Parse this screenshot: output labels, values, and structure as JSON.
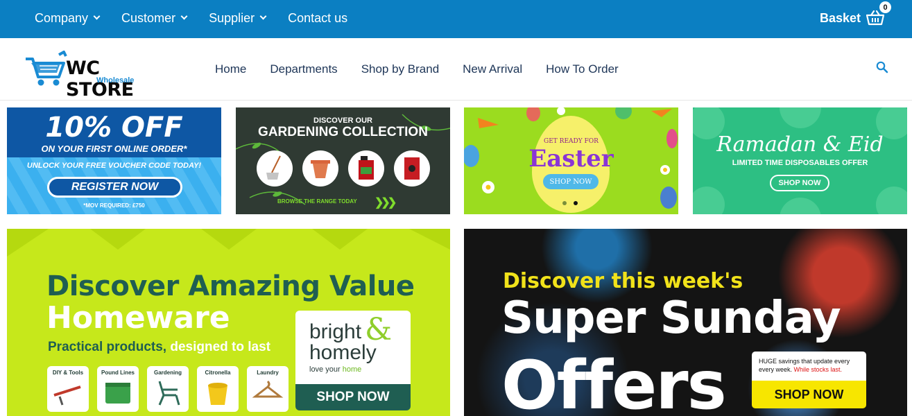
{
  "topbar": {
    "nav": [
      {
        "label": "Company",
        "dropdown": true
      },
      {
        "label": "Customer",
        "dropdown": true
      },
      {
        "label": "Supplier",
        "dropdown": true
      },
      {
        "label": "Contact us",
        "dropdown": false
      }
    ],
    "basket_label": "Basket",
    "basket_count": "0",
    "background": "#0b7fc2"
  },
  "header": {
    "logo_text": "WC STORE",
    "logo_sub": "Wholesale",
    "nav": [
      "Home",
      "Departments",
      "Shop by Brand",
      "New Arrival",
      "How To Order"
    ],
    "search_icon": "search-icon"
  },
  "banners": {
    "voucher": {
      "big": "10% OFF",
      "sub": "ON YOUR FIRST ONLINE ORDER*",
      "unlock": "UNLOCK YOUR FREE VOUCHER CODE TODAY!",
      "button": "REGISTER NOW",
      "mov": "*MOV REQUIRED: £750"
    },
    "gardening": {
      "top": "DISCOVER OUR",
      "title": "GARDENING COLLECTION",
      "browse": "BROWSE THE RANGE TODAY",
      "arrows": "❯❯❯"
    },
    "easter": {
      "ready": "GET READY FOR",
      "title": "Easter",
      "button": "SHOP NOW"
    },
    "ramadan": {
      "title": "Ramadan & Eid",
      "sub": "LIMITED TIME DISPOSABLES OFFER",
      "button": "SHOP NOW"
    },
    "homeware": {
      "line1": "Discover Amazing Value",
      "line2": "Homeware",
      "line3a": "Practical products,",
      "line3b": " designed to last",
      "cards": [
        "DIY & Tools",
        "Pound Lines",
        "Gardening",
        "Citronella",
        "Laundry"
      ],
      "brand_bright": "bright",
      "brand_amp": "&",
      "brand_homely": "homely",
      "brand_love_a": "love your ",
      "brand_love_b": "home",
      "button": "SHOP NOW"
    },
    "sunday": {
      "line1": "Discover this week's",
      "line2": "Super Sunday",
      "line3": "Offers",
      "box_a": "HUGE savings that update every every week. ",
      "box_b": "While stocks last.",
      "button": "SHOP NOW"
    }
  }
}
